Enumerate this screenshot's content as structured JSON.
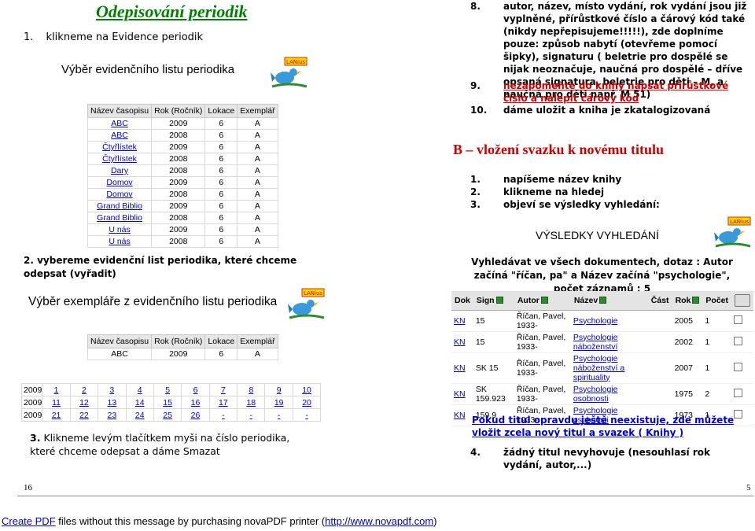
{
  "left_page": {
    "title": "Odepisování periodik",
    "step1": {
      "num": "1.",
      "text": "klikneme na Evidence periodik"
    },
    "select_list_title": "Výběr evidenčního listu periodika",
    "logo_text": "LANius",
    "list_table": {
      "headers": [
        "Název časopisu",
        "Rok (Ročník)",
        "Lokace",
        "Exemplář"
      ],
      "rows": [
        [
          "ABC",
          "2009",
          "6",
          "A"
        ],
        [
          "ABC",
          "2008",
          "6",
          "A"
        ],
        [
          "Čtyřlístek",
          "2009",
          "6",
          "A"
        ],
        [
          "Čtyřlístek",
          "2008",
          "6",
          "A"
        ],
        [
          "Dary",
          "2008",
          "6",
          "A"
        ],
        [
          "Domov",
          "2009",
          "6",
          "A"
        ],
        [
          "Domov",
          "2008",
          "6",
          "A"
        ],
        [
          "Grand Biblio",
          "2009",
          "6",
          "A"
        ],
        [
          "Grand Biblio",
          "2008",
          "6",
          "A"
        ],
        [
          "U nás",
          "2009",
          "6",
          "A"
        ],
        [
          "U nás",
          "2008",
          "6",
          "A"
        ]
      ]
    },
    "step2": {
      "num": "2.",
      "text": "vybereme evidenční list periodika, které chceme odepsat (vyřadit)"
    },
    "select_copy_title": "Výběr exempláře z evidenčního listu periodika",
    "copy_table": {
      "headers": [
        "Název časopisu",
        "Rok (Ročník)",
        "Lokace",
        "Exemplář"
      ],
      "row": [
        "ABC",
        "2009",
        "6",
        "A"
      ]
    },
    "year_grid": [
      {
        "year": "2009",
        "cells": [
          "1",
          "2",
          "3",
          "4",
          "5",
          "6",
          "7",
          "8",
          "9",
          "10"
        ]
      },
      {
        "year": "2009",
        "cells": [
          "11",
          "12",
          "13",
          "14",
          "15",
          "16",
          "17",
          "18",
          "19",
          "20"
        ]
      },
      {
        "year": "2009",
        "cells": [
          "21",
          "22",
          "23",
          "24",
          "25",
          "26",
          "-",
          "-",
          "-",
          "-"
        ]
      }
    ],
    "step3": {
      "num": "3.",
      "text": "Klikneme levým tlačítkem myši na číslo periodika, které chceme odepsat a dáme Smazat"
    },
    "page_number": "16"
  },
  "right_page": {
    "step8": {
      "num": "8.",
      "text": "autor, název, místo vydání, rok vydání jsou již vyplněné, přírůstkové číslo a čárový kód také (nikdy nepřepisujeme!!!!!), zde doplníme pouze: způsob nabytí (otevřeme pomocí šipky), signaturu ( beletrie pro dospělé se nijak neoznačuje, naučná pro dospělé – dříve opsaná signatura, beletrie pro děti – M, a naučná pro děti např. M 51)"
    },
    "step9": {
      "num": "9.",
      "text": "nezapomeňte do knihy napsat přírůstkové číslo a nalepit čárový kód"
    },
    "step10": {
      "num": "10.",
      "text": "dáme uložit a kniha je zkatalogizovaná"
    },
    "section_b_title": "B – vložení svazku k novému titulu",
    "b_steps": [
      {
        "num": "1.",
        "text": "napíšeme název knihy"
      },
      {
        "num": "2.",
        "text": "klikneme na hledej"
      },
      {
        "num": "3.",
        "text": "objeví se výsledky vyhledání:"
      }
    ],
    "results_title": "VÝSLEDKY VYHLEDÁNÍ",
    "logo_text": "LANius",
    "search_summary": "Vyhledávat ve všech dokumentech, dotaz : Autor začíná \"říčan, pa\" a Název začíná \"psychologie\", počet záznamů : 5",
    "results_table": {
      "headers": [
        "Dok",
        "Sign",
        "Autor",
        "Název",
        "Část",
        "Rok",
        "Počet"
      ],
      "rows": [
        {
          "dok": "KN",
          "sign": "15",
          "author": "Říčan, Pavel, 1933-",
          "title": "Psychologie",
          "part": "",
          "year": "2005",
          "count": "1"
        },
        {
          "dok": "KN",
          "sign": "15",
          "author": "Říčan, Pavel, 1933-",
          "title": "Psychologie náboženství",
          "part": "",
          "year": "2002",
          "count": "1"
        },
        {
          "dok": "KN",
          "sign": "SK 15",
          "author": "Říčan, Pavel, 1933-",
          "title": "Psychologie náboženství a spirituality",
          "part": "",
          "year": "2007",
          "count": "1"
        },
        {
          "dok": "KN",
          "sign": "SK 159.923",
          "author": "Říčan, Pavel, 1933-",
          "title": "Psychologie osobnosti",
          "part": "",
          "year": "1975",
          "count": "2"
        },
        {
          "dok": "KN",
          "sign": "159.9",
          "author": "Říčan, Pavel, 1933-",
          "title": "Psychologie osobnosti",
          "part": "",
          "year": "1973",
          "count": "1"
        }
      ]
    },
    "no_title_link": "Pokud titul opravdu ještě neexistuje, zde můžete vložit zcela nový titul a svazek ( Knihy )",
    "step4": {
      "num": "4.",
      "text": "žádný titul nevyhovuje (nesouhlasí rok vydání, autor,...)"
    },
    "page_number": "5"
  },
  "footer": {
    "link1": "Create PDF",
    "text1": " files without this message by purchasing novaPDF printer (",
    "link2": "http://www.novapdf.com",
    "text2": ")"
  }
}
